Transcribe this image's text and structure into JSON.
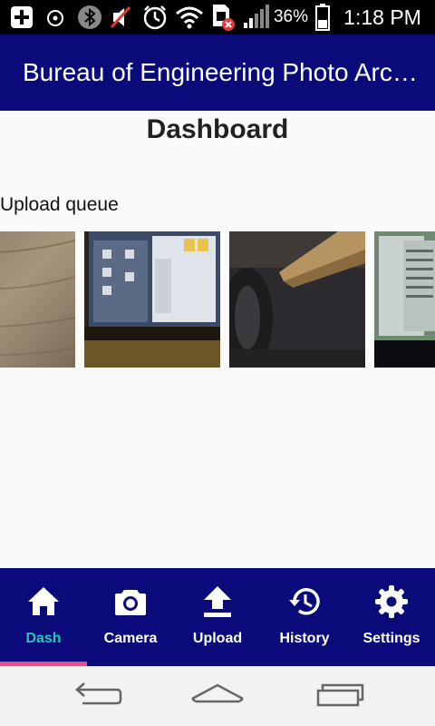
{
  "status_bar": {
    "battery_percent": "36%",
    "time": "1:18 PM",
    "icons": [
      "add-box-icon",
      "alarm-icon",
      "bluetooth-icon",
      "ringer-muted-icon",
      "clock-icon",
      "wifi-icon",
      "sim-error-icon",
      "signal-icon",
      "battery-icon"
    ]
  },
  "app_bar": {
    "title": "Bureau of Engineering Photo Archive"
  },
  "main": {
    "heading": "Dashboard",
    "upload_queue_label": "Upload queue",
    "thumbnails": [
      "wood-surface-photo",
      "laptop-screen-photo",
      "wood-edge-photo",
      "computer-screen-photo"
    ]
  },
  "bottom_nav": {
    "active_index": 0,
    "items": [
      {
        "label": "Dash",
        "icon": "home-icon"
      },
      {
        "label": "Camera",
        "icon": "camera-icon"
      },
      {
        "label": "Upload",
        "icon": "upload-icon"
      },
      {
        "label": "History",
        "icon": "history-icon"
      },
      {
        "label": "Settings",
        "icon": "gear-icon"
      }
    ]
  },
  "system_nav": {
    "icons": [
      "back-icon",
      "home-icon",
      "recent-apps-icon"
    ]
  },
  "colors": {
    "primary": "#0a0a7a",
    "active_label": "#22c7b8",
    "indicator": "#e64d8a"
  }
}
